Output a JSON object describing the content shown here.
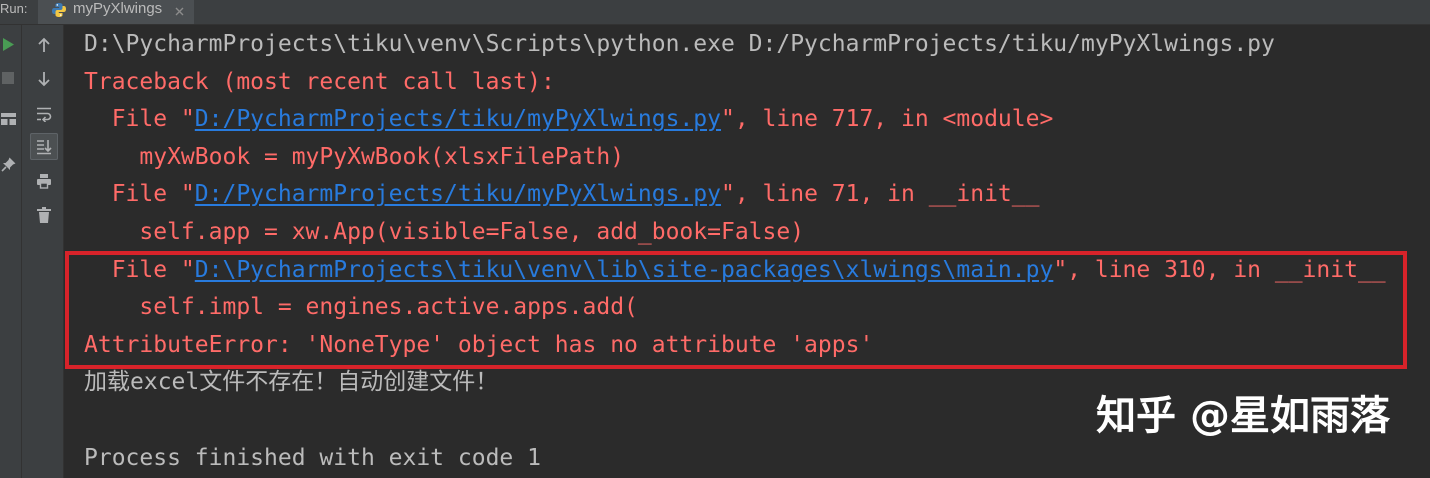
{
  "run_bar": {
    "label": "Run:",
    "tab": {
      "title": "myPyXlwings",
      "icon": "python-icon",
      "close_icon": "close-icon"
    }
  },
  "run_toolbar": {
    "icons": [
      "run-icon",
      "stop-icon",
      "restore-layout-icon",
      "pin-icon"
    ]
  },
  "console_toolbar": {
    "icons": [
      "up-arrow-icon",
      "down-arrow-icon",
      "soft-wrap-icon",
      "scroll-to-end-icon",
      "print-icon",
      "trash-icon"
    ],
    "scroll_to_end_active": true
  },
  "console": {
    "lines": [
      {
        "text": "D:\\PycharmProjects\\tiku\\venv\\Scripts\\python.exe D:/PycharmProjects/tiku/myPyXlwings.py"
      },
      {
        "text": "Traceback (most recent call last):"
      },
      {
        "prefix": "  File \"",
        "link": "D:/PycharmProjects/tiku/myPyXlwings.py",
        "suffix": "\", line 717, in <module>"
      },
      {
        "text": "    myXwBook = myPyXwBook(xlsxFilePath)"
      },
      {
        "prefix": "  File \"",
        "link": "D:/PycharmProjects/tiku/myPyXlwings.py",
        "suffix": "\", line 71, in __init__"
      },
      {
        "text": "    self.app = xw.App(visible=False, add_book=False)"
      },
      {
        "prefix": "  File \"",
        "link": "D:\\PycharmProjects\\tiku\\venv\\lib\\site-packages\\xlwings\\main.py",
        "suffix": "\", line 310, in __init__"
      },
      {
        "text": "    self.impl = engines.active.apps.add("
      },
      {
        "text": "AttributeError: 'NoneType' object has no attribute 'apps'"
      },
      {
        "text": "加载excel文件不存在！自动创建文件！"
      },
      {
        "text": "Process finished with exit code 1"
      }
    ]
  },
  "watermark": {
    "text": "知乎 @星如雨落"
  },
  "colors": {
    "background": "#2b2b2b",
    "toolbar": "#3c3f41",
    "stdout": "#bbbbbb",
    "stderr": "#ff6b68",
    "link": "#287bde",
    "highlight": "#d8232a",
    "run_green": "#499c54",
    "icon": "#afb1b3",
    "watermark": "#ffffff",
    "tab_active": "#4b4f52"
  }
}
